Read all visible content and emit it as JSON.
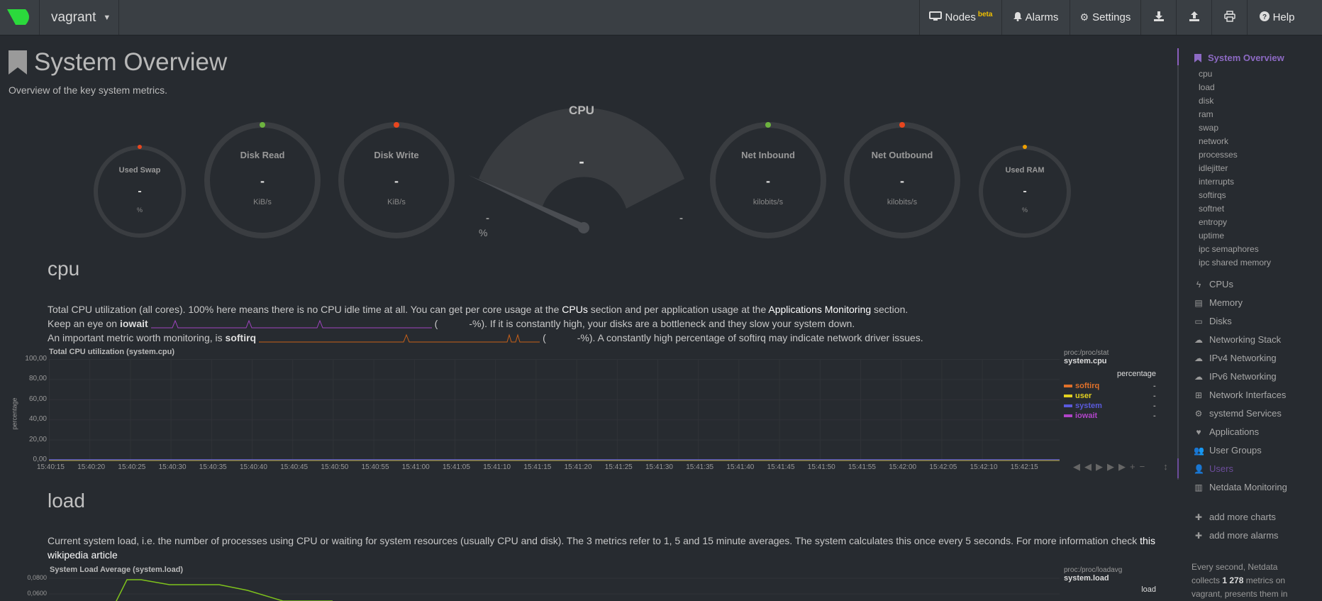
{
  "topbar": {
    "hostname": "vagrant",
    "nodes_label": "Nodes",
    "nodes_badge": "beta",
    "alarms_label": "Alarms",
    "settings_label": "Settings",
    "help_label": "Help"
  },
  "page": {
    "title": "System Overview",
    "subtitle": "Overview of the key system metrics."
  },
  "gauges": {
    "used_swap": {
      "label": "Used Swap",
      "value": "-",
      "unit": "%"
    },
    "disk_read": {
      "label": "Disk Read",
      "value": "-",
      "unit": "KiB/s"
    },
    "disk_write": {
      "label": "Disk Write",
      "value": "-",
      "unit": "KiB/s"
    },
    "cpu": {
      "label": "CPU",
      "value": "-",
      "min": "-",
      "max": "-",
      "unit": "%"
    },
    "net_inbound": {
      "label": "Net Inbound",
      "value": "-",
      "unit": "kilobits/s"
    },
    "net_outbound": {
      "label": "Net Outbound",
      "value": "-",
      "unit": "kilobits/s"
    },
    "used_ram": {
      "label": "Used RAM",
      "value": "-",
      "unit": "%"
    }
  },
  "cpu_section": {
    "heading": "cpu",
    "line1_a": "Total CPU utilization (all cores). 100% here means there is no CPU idle time at all. You can get per core usage at the ",
    "line1_link1": "CPUs",
    "line1_b": " section and per application usage at the ",
    "line1_link2": "Applications Monitoring",
    "line1_c": " section.",
    "line2_a": "Keep an eye on ",
    "line2_metric": "iowait",
    "line2_b": "(",
    "line2_c": "-%). If it is constantly high, your disks are a bottleneck and they slow your system down.",
    "line3_a": "An important metric worth monitoring, is ",
    "line3_metric": "softirq",
    "line3_b": "(",
    "line3_c": "-%). A constantly high percentage of softirq may indicate network driver issues."
  },
  "chart_data": [
    {
      "type": "area",
      "title": "Total CPU utilization (system.cpu)",
      "ylabel": "percentage",
      "ylim": [
        0,
        100
      ],
      "yticks": [
        "100,00",
        "80,00",
        "60,00",
        "40,00",
        "20,00",
        "0,00"
      ],
      "xticks": [
        "15:40:15",
        "15:40:20",
        "15:40:25",
        "15:40:30",
        "15:40:35",
        "15:40:40",
        "15:40:45",
        "15:40:50",
        "15:40:55",
        "15:41:00",
        "15:41:05",
        "15:41:10",
        "15:41:15",
        "15:41:20",
        "15:41:25",
        "15:41:30",
        "15:41:35",
        "15:41:40",
        "15:41:45",
        "15:41:50",
        "15:41:55",
        "15:42:00",
        "15:42:05",
        "15:42:10",
        "15:42:15"
      ],
      "legend_source": "proc:/proc/stat",
      "legend_context": "system.cpu",
      "legend_unit": "percentage",
      "series": [
        {
          "name": "softirq",
          "color": "#e0702a",
          "value": "-"
        },
        {
          "name": "user",
          "color": "#e2d020",
          "value": "-"
        },
        {
          "name": "system",
          "color": "#5a5adc",
          "value": "-"
        },
        {
          "name": "iowait",
          "color": "#b044c8",
          "value": "-"
        }
      ]
    },
    {
      "type": "line",
      "title": "System Load Average (system.load)",
      "yticks": [
        "0,0800",
        "0,0600"
      ],
      "legend_source": "proc:/proc/loadavg",
      "legend_context": "system.load",
      "legend_unit": "load"
    }
  ],
  "load_section": {
    "heading": "load",
    "text": "Current system load, i.e. the number of processes using CPU or waiting for system resources (usually CPU and disk). The 3 metrics refer to 1, 5 and 15 minute averages. The system calculates this once every 5 seconds. For more information check ",
    "link1": "this",
    "link2": "wikipedia article"
  },
  "sidebar": {
    "title": "System Overview",
    "subitems": [
      "cpu",
      "load",
      "disk",
      "ram",
      "swap",
      "network",
      "processes",
      "idlejitter",
      "interrupts",
      "softirqs",
      "softnet",
      "entropy",
      "uptime",
      "ipc semaphores",
      "ipc shared memory"
    ],
    "categories": [
      {
        "label": "CPUs",
        "icon": "bolt-icon",
        "glyph": "ϟ"
      },
      {
        "label": "Memory",
        "icon": "memory-icon",
        "glyph": "▤"
      },
      {
        "label": "Disks",
        "icon": "hdd-icon",
        "glyph": "▭"
      },
      {
        "label": "Networking Stack",
        "icon": "cloud-icon",
        "glyph": "☁"
      },
      {
        "label": "IPv4 Networking",
        "icon": "cloud-icon",
        "glyph": "☁"
      },
      {
        "label": "IPv6 Networking",
        "icon": "cloud-icon",
        "glyph": "☁"
      },
      {
        "label": "Network Interfaces",
        "icon": "sitemap-icon",
        "glyph": "⊞"
      },
      {
        "label": "systemd Services",
        "icon": "cogs-icon",
        "glyph": "⚙"
      },
      {
        "label": "Applications",
        "icon": "heartbeat-icon",
        "glyph": "♥"
      },
      {
        "label": "User Groups",
        "icon": "users-icon",
        "glyph": "👥"
      },
      {
        "label": "Users",
        "icon": "user-icon",
        "glyph": "👤"
      },
      {
        "label": "Netdata Monitoring",
        "icon": "bar-chart-icon",
        "glyph": "▥"
      }
    ],
    "add_charts": "add more charts",
    "add_alarms": "add more alarms",
    "footer_a": "Every second, Netdata collects ",
    "footer_metrics": "1 278",
    "footer_b": " metrics on vagrant, presents them in"
  }
}
